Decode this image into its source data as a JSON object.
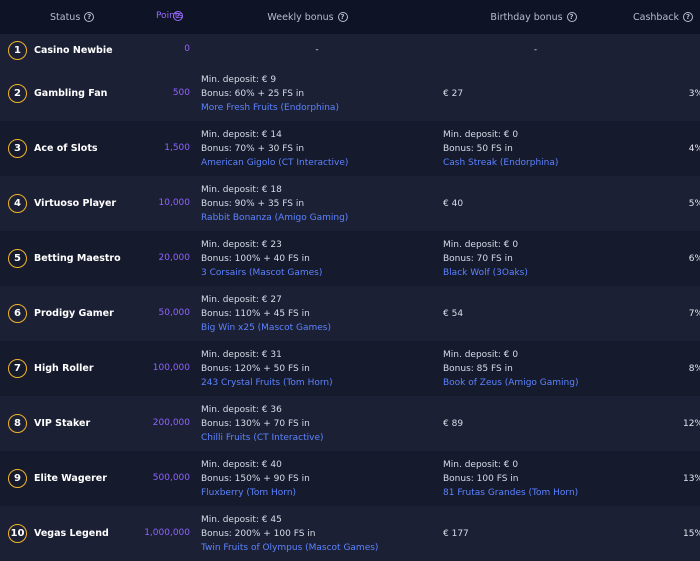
{
  "header": {
    "status": "Status",
    "points": "Points",
    "weekly": "Weekly bonus",
    "birthday": "Birthday bonus",
    "cashback": "Cashback"
  },
  "help_icon": "?",
  "rows": [
    {
      "num": "1",
      "name": "Casino Newbie",
      "points": "0",
      "weekly_dash": "-",
      "birthday_dash": "-",
      "cashback": "-"
    },
    {
      "num": "2",
      "name": "Gambling Fan",
      "points": "500",
      "w_dep": "Min. deposit: € 9",
      "w_bonus": "Bonus: 60% + 25 FS in",
      "w_game": "More Fresh Fruits (Endorphina)",
      "b_single": "€ 27",
      "cashback": "3%"
    },
    {
      "num": "3",
      "name": "Ace of Slots",
      "points": "1,500",
      "w_dep": "Min. deposit: € 14",
      "w_bonus": "Bonus: 70% + 30 FS in",
      "w_game": "American Gigolo (CT Interactive)",
      "b_dep": "Min. deposit: € 0",
      "b_bonus": "Bonus: 50 FS in",
      "b_game": "Cash Streak (Endorphina)",
      "cashback": "4%"
    },
    {
      "num": "4",
      "name": "Virtuoso Player",
      "points": "10,000",
      "w_dep": "Min. deposit: € 18",
      "w_bonus": "Bonus: 90% + 35 FS in",
      "w_game": "Rabbit Bonanza (Amigo Gaming)",
      "b_single": "€ 40",
      "cashback": "5%"
    },
    {
      "num": "5",
      "name": "Betting Maestro",
      "points": "20,000",
      "w_dep": "Min. deposit: € 23",
      "w_bonus": "Bonus: 100% + 40 FS in",
      "w_game": "3 Corsairs (Mascot Games)",
      "b_dep": "Min. deposit: € 0",
      "b_bonus": "Bonus: 70 FS in",
      "b_game": "Black Wolf (3Oaks)",
      "cashback": "6%"
    },
    {
      "num": "6",
      "name": "Prodigy Gamer",
      "points": "50,000",
      "w_dep": "Min. deposit: € 27",
      "w_bonus": "Bonus: 110% + 45 FS in",
      "w_game": "Big Win x25 (Mascot Games)",
      "b_single": "€ 54",
      "cashback": "7%"
    },
    {
      "num": "7",
      "name": "High Roller",
      "points": "100,000",
      "w_dep": "Min. deposit: € 31",
      "w_bonus": "Bonus: 120% + 50 FS in",
      "w_game": "243 Crystal Fruits (Tom Horn)",
      "b_dep": "Min. deposit: € 0",
      "b_bonus": "Bonus: 85 FS in",
      "b_game": "Book of Zeus (Amigo Gaming)",
      "cashback": "8%"
    },
    {
      "num": "8",
      "name": "VIP Staker",
      "points": "200,000",
      "w_dep": "Min. deposit: € 36",
      "w_bonus": "Bonus: 130% + 70 FS in",
      "w_game": "Chilli Fruits (CT Interactive)",
      "b_single": "€ 89",
      "cashback": "12%"
    },
    {
      "num": "9",
      "name": "Elite Wagerer",
      "points": "500,000",
      "w_dep": "Min. deposit: € 40",
      "w_bonus": "Bonus: 150% + 90 FS in",
      "w_game": "Fluxberry (Tom Horn)",
      "b_dep": "Min. deposit: € 0",
      "b_bonus": "Bonus: 100 FS in",
      "b_game": "81 Frutas Grandes (Tom Horn)",
      "cashback": "13%"
    },
    {
      "num": "10",
      "name": "Vegas Legend",
      "points": "1,000,000",
      "w_dep": "Min. deposit: € 45",
      "w_bonus": "Bonus: 200% + 100 FS in",
      "w_game": "Twin Fruits of Olympus (Mascot Games)",
      "b_single": "€ 177",
      "cashback": "15%"
    }
  ],
  "colors": {
    "background": "#0f1326",
    "row_odd": "#1c2035",
    "row_even": "#161a2d",
    "badge_ring": "#f0b429",
    "points": "#8f63ff",
    "game_link": "#5b83ff"
  }
}
